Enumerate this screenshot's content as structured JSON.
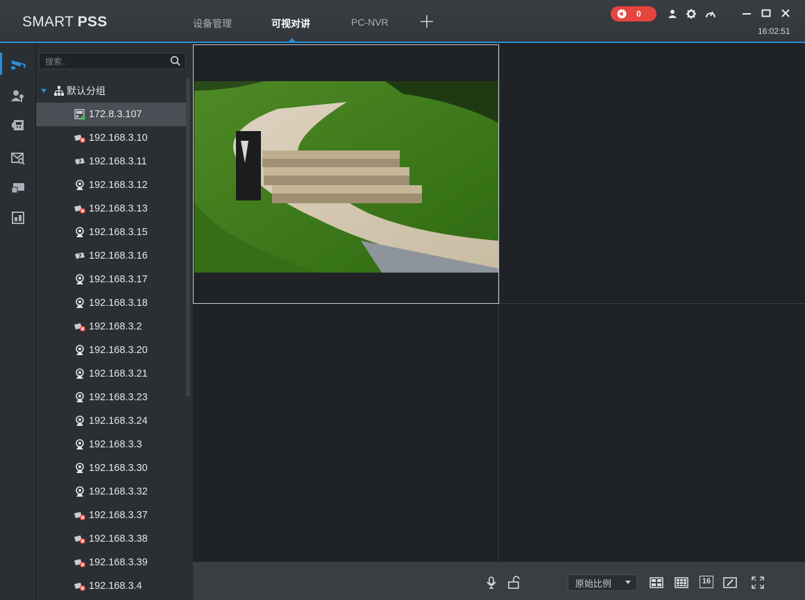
{
  "app": {
    "brand_prefix": "SMART ",
    "brand_bold": "PSS"
  },
  "tabs": [
    {
      "label": "设备管理",
      "active": false
    },
    {
      "label": "可视对讲",
      "active": true
    },
    {
      "label": "PC-NVR",
      "active": false
    }
  ],
  "titlebar": {
    "alarm_count": "0",
    "clock": "16:02:51",
    "icons": [
      "speaker-icon",
      "user-icon",
      "gear-icon",
      "gauge-icon",
      "minimize-icon",
      "maximize-icon",
      "close-icon"
    ]
  },
  "colors": {
    "accent": "#2a8fd6",
    "alarm": "#e5443f",
    "online": "#3fbf4a",
    "offline": "#e5443f"
  },
  "rail": {
    "icons": [
      "camera-icon",
      "contacts-icon",
      "door-station-icon",
      "message-search-icon",
      "card-icon",
      "report-icon"
    ],
    "active_index": 0
  },
  "sidebar": {
    "search_placeholder": "搜索..",
    "group_label": "默认分组",
    "devices": [
      {
        "label": "172.8.3.107",
        "icon": "nvr-online-icon",
        "selected": true
      },
      {
        "label": "192.168.3.10",
        "icon": "camera-offline-icon"
      },
      {
        "label": "192.168.3.11",
        "icon": "camera-unknown-icon"
      },
      {
        "label": "192.168.3.12",
        "icon": "webcam-icon"
      },
      {
        "label": "192.168.3.13",
        "icon": "camera-offline-icon"
      },
      {
        "label": "192.168.3.15",
        "icon": "webcam-icon"
      },
      {
        "label": "192.168.3.16",
        "icon": "camera-unknown-icon"
      },
      {
        "label": "192.168.3.17",
        "icon": "webcam-icon"
      },
      {
        "label": "192.168.3.18",
        "icon": "webcam-icon"
      },
      {
        "label": "192.168.3.2",
        "icon": "camera-offline-icon"
      },
      {
        "label": "192.168.3.20",
        "icon": "webcam-icon"
      },
      {
        "label": "192.168.3.21",
        "icon": "webcam-icon"
      },
      {
        "label": "192.168.3.23",
        "icon": "webcam-icon"
      },
      {
        "label": "192.168.3.24",
        "icon": "webcam-icon"
      },
      {
        "label": "192.168.3.3",
        "icon": "webcam-icon"
      },
      {
        "label": "192.168.3.30",
        "icon": "webcam-icon"
      },
      {
        "label": "192.168.3.32",
        "icon": "webcam-icon"
      },
      {
        "label": "192.168.3.37",
        "icon": "camera-offline-icon"
      },
      {
        "label": "192.168.3.38",
        "icon": "camera-offline-icon"
      },
      {
        "label": "192.168.3.39",
        "icon": "camera-offline-icon"
      },
      {
        "label": "192.168.3.4",
        "icon": "camera-offline-icon"
      }
    ]
  },
  "toolbar": {
    "aspect_ratio_label": "原始比例",
    "layout_16_label": "16",
    "icons": [
      "microphone-icon",
      "unlock-icon",
      "layout-4-icon",
      "layout-9-icon",
      "layout-16-icon",
      "edit-layout-icon",
      "fullscreen-icon"
    ]
  }
}
